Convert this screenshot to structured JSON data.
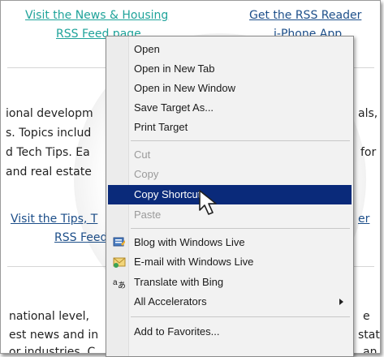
{
  "page": {
    "link_news_line1": "Visit the News & Housing",
    "link_news_line2": "RSS Feed page",
    "link_rss_line1": "Get the RSS Reader",
    "link_rss_line2": "i-Phone App",
    "para1_line1": "ional developm",
    "para1_line1_right": "als,",
    "para1_line2": "s. Topics includ",
    "para1_line3": "d Tech Tips. Ea",
    "para1_line3_right": "for",
    "para1_line4": "and real estate",
    "link_tips_line1": "Visit the Tips, T",
    "link_tips_right": "er",
    "link_tips_line2": "RSS Feed",
    "para2_line1": "national level,",
    "para2_line1_right": "e",
    "para2_line2": "est news and in",
    "para2_line2_right": "stat",
    "para2_line3": "or industries. C",
    "para2_line3_right": "an"
  },
  "context_menu": {
    "items": [
      {
        "label": "Open",
        "state": "normal"
      },
      {
        "label": "Open in New Tab",
        "state": "normal"
      },
      {
        "label": "Open in New Window",
        "state": "normal"
      },
      {
        "label": "Save Target As...",
        "state": "normal"
      },
      {
        "label": "Print Target",
        "state": "normal"
      },
      {
        "label": "Cut",
        "state": "disabled"
      },
      {
        "label": "Copy",
        "state": "disabled"
      },
      {
        "label": "Copy Shortcut",
        "state": "selected"
      },
      {
        "label": "Paste",
        "state": "disabled"
      },
      {
        "label": "Blog with Windows Live",
        "icon": "blog-icon"
      },
      {
        "label": "E-mail with Windows Live",
        "icon": "email-icon"
      },
      {
        "label": "Translate with Bing",
        "icon": "translate-icon"
      },
      {
        "label": "All Accelerators",
        "submenu": true
      },
      {
        "label": "Add to Favorites..."
      }
    ]
  },
  "colors": {
    "link_teal": "#1fa39a",
    "link_blue": "#1d4f8a",
    "menu_highlight": "#0a2a7a"
  }
}
